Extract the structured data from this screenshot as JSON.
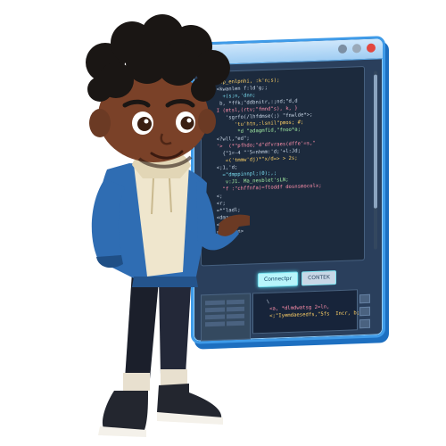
{
  "buttons": {
    "primary_label": "Connectpr",
    "secondary_label": "CONTEK"
  },
  "editor": {
    "lines": [
      {
        "text": "<?xhp_enlpnhi, :k'n;s);",
        "color": "#ffd166"
      },
      {
        "text": "  <kwanlen f:ld'g;;",
        "color": "#c9d6e6"
      },
      {
        "text": "    +(s;n,'dnn;",
        "color": "#7bdff2"
      },
      {
        "text": "   b, *ffk;\"ddbnitr,:;nd;\"d,d",
        "color": "#c9d6e6"
      },
      {
        "text": "  I (mtsl,(rtv;\"fmnd\"s), k, }",
        "color": "#ff8fab"
      },
      {
        "text": "     'sgrfo(/lhfdmse(;) \"fnwlde*>;",
        "color": "#c9d6e6"
      },
      {
        "text": "        'tu'htn,:lsnil\"pmos; #;",
        "color": "#ffd166"
      },
      {
        "text": "         *d \"adagmfid,\"fnoo*a;",
        "color": "#a0e8a0"
      },
      {
        "text": "  <?wll,\"ed\";",
        "color": "#c9d6e6"
      },
      {
        "text": "  '>  (*\"pfhdo;\"d\"dfvraes(dffe'=s,\"",
        "color": "#ff8fab"
      },
      {
        "text": "    {\"1=-4 \"'5=nhmm:'d;'+l:Jd;",
        "color": "#c9d6e6"
      },
      {
        "text": "     =('tmmw'dj)*\"x/d=> > 2s;",
        "color": "#ffd166"
      },
      {
        "text": "  <;1,'d;",
        "color": "#c9d6e6"
      },
      {
        "text": "    =\"dmppinnpl;(0);,;",
        "color": "#7bdff2"
      },
      {
        "text": "     v:J1. Ma_nesblet'sLN;",
        "color": "#a0e8a0"
      },
      {
        "text": "    \"f :\"chffnfa)=ftoddf dosnsmocolx;",
        "color": "#ff8fab"
      },
      {
        "text": "  <;",
        "color": "#c9d6e6"
      },
      {
        "text": "  <r;",
        "color": "#c9d6e6"
      },
      {
        "text": "  =*\"ladl;",
        "color": "#c9d6e6"
      },
      {
        "text": "  <dmz;",
        "color": "#c9d6e6"
      },
      {
        "text": "  <fhdl>",
        "color": "#c9d6e6"
      },
      {
        "text": "  <hdjolin>",
        "color": "#c9d6e6"
      }
    ]
  },
  "console": {
    "lines": [
      {
        "text": "  \\",
        "color": "#c9d6e6"
      },
      {
        "text": "   <a, *dlmdwatsg 2=ln,",
        "color": "#ff8fab"
      },
      {
        "text": "   <;\"Iyemdaesedfs,\"5fs  Incr, b;",
        "color": "#ffd166"
      }
    ]
  },
  "colors": {
    "window_frame": "#3f9be8",
    "editor_bg": "#1c2a3d",
    "accent_cyan": "#56e0f0",
    "close_button": "#e2473f"
  }
}
